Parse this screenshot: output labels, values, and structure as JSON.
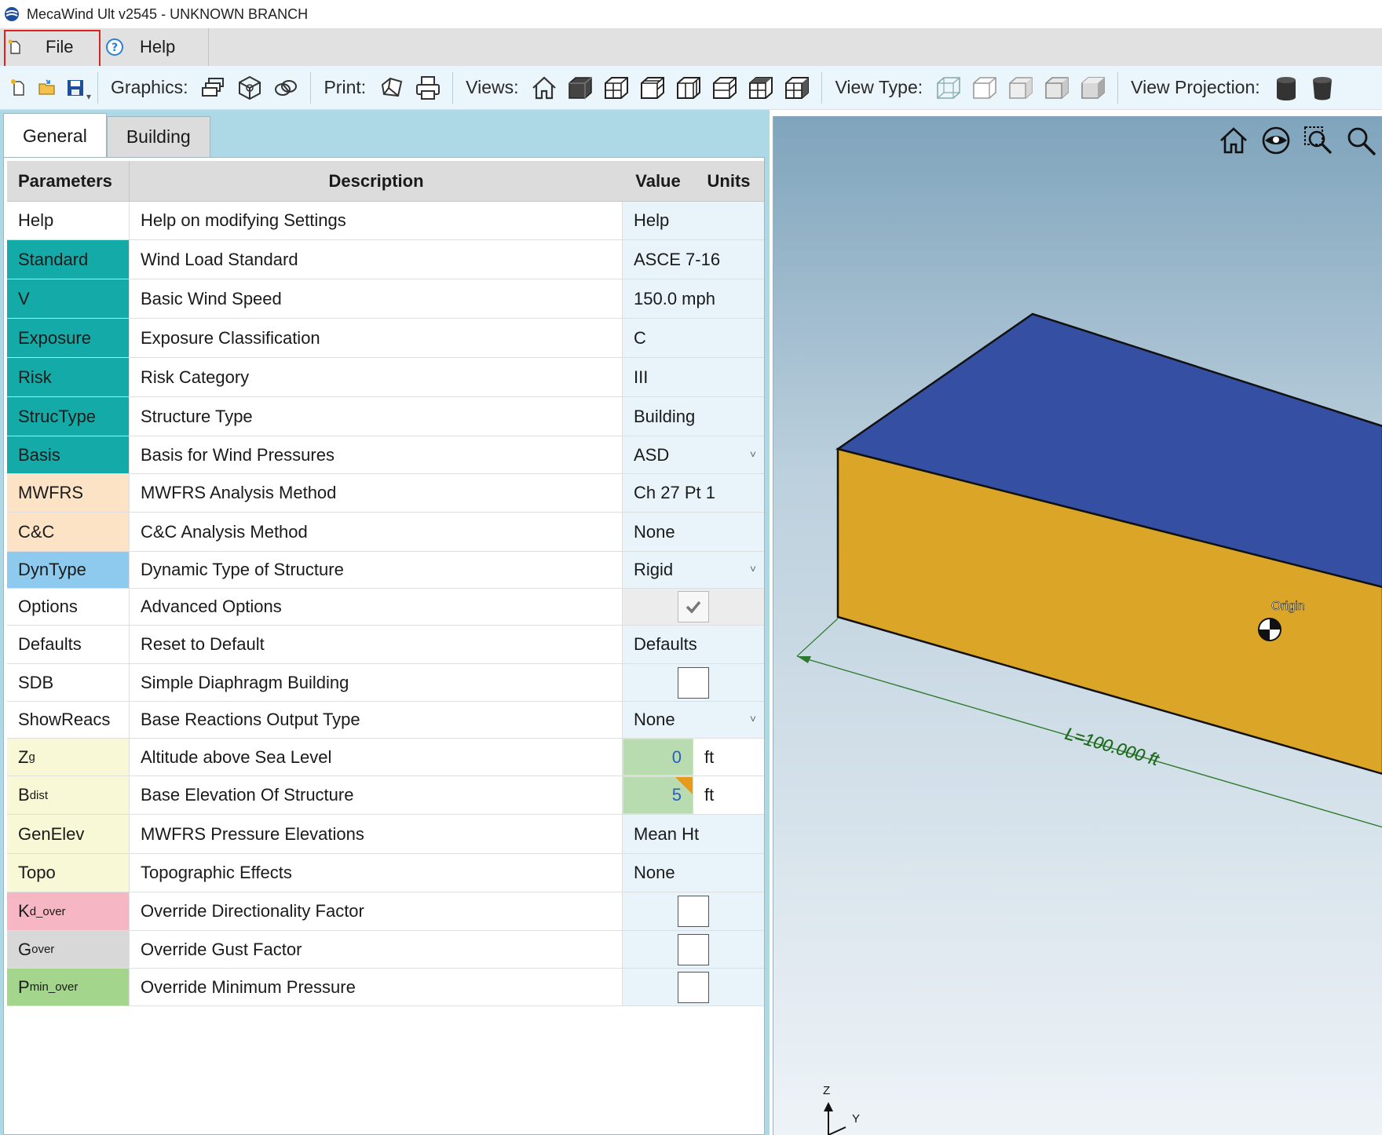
{
  "window": {
    "title": "MecaWind Ult v2545  - UNKNOWN BRANCH"
  },
  "menu": {
    "file": "File",
    "help": "Help"
  },
  "toolbar": {
    "graphics_label": "Graphics:",
    "print_label": "Print:",
    "views_label": "Views:",
    "view_type_label": "View Type:",
    "view_projection_label": "View Projection:"
  },
  "tabs": {
    "general": "General",
    "building": "Building"
  },
  "grid": {
    "headers": {
      "parameters": "Parameters",
      "description": "Description",
      "value": "Value",
      "units": "Units"
    },
    "rows": [
      {
        "param": "Help",
        "desc": "Help on modifying Settings",
        "value": "Help"
      },
      {
        "param": "Standard",
        "desc": "Wind Load Standard",
        "value": "ASCE 7-16"
      },
      {
        "param": "V",
        "desc": "Basic Wind Speed",
        "value": "150.0 mph"
      },
      {
        "param": "Exposure",
        "desc": "Exposure Classification",
        "value": "C"
      },
      {
        "param": "Risk",
        "desc": "Risk Category",
        "value": "III"
      },
      {
        "param": "StrucType",
        "desc": "Structure Type",
        "value": "Building"
      },
      {
        "param": "Basis",
        "desc": "Basis for Wind Pressures",
        "value": "ASD"
      },
      {
        "param": "MWFRS",
        "desc": "MWFRS Analysis Method",
        "value": "Ch 27 Pt 1"
      },
      {
        "param": "C&C",
        "desc": "C&C Analysis Method",
        "value": "None"
      },
      {
        "param": "DynType",
        "desc": "Dynamic Type of Structure",
        "value": "Rigid"
      },
      {
        "param": "Options",
        "desc": "Advanced Options",
        "checked": true
      },
      {
        "param": "Defaults",
        "desc": "Reset to Default",
        "value": "Defaults"
      },
      {
        "param": "SDB",
        "desc": "Simple Diaphragm Building",
        "checked": false
      },
      {
        "param": "ShowReacs",
        "desc": "Base Reactions Output Type",
        "value": "None"
      },
      {
        "param": "Z",
        "param_sub": "g",
        "desc": "Altitude above Sea Level",
        "value": "0",
        "unit": "ft"
      },
      {
        "param": "B",
        "param_sub": "dist",
        "desc": "Base Elevation Of Structure",
        "value": "5",
        "unit": "ft"
      },
      {
        "param": "GenElev",
        "desc": "MWFRS Pressure Elevations",
        "value": "Mean Ht"
      },
      {
        "param": "Topo",
        "desc": "Topographic Effects",
        "value": "None"
      },
      {
        "param": "K",
        "param_sub": "d_over",
        "desc": "Override Directionality Factor",
        "checked": false
      },
      {
        "param": "G",
        "param_sub": "over",
        "desc": "Override Gust Factor",
        "checked": false
      },
      {
        "param": "P",
        "param_sub": "min_over",
        "desc": "Override Minimum Pressure",
        "checked": false
      }
    ]
  },
  "viewport": {
    "origin_label": "Origin",
    "dimension_label": "L=100.000 ft",
    "axis_z": "Z",
    "axis_y": "Y",
    "roof_color": "#3550a3",
    "wall_color": "#dba527"
  }
}
